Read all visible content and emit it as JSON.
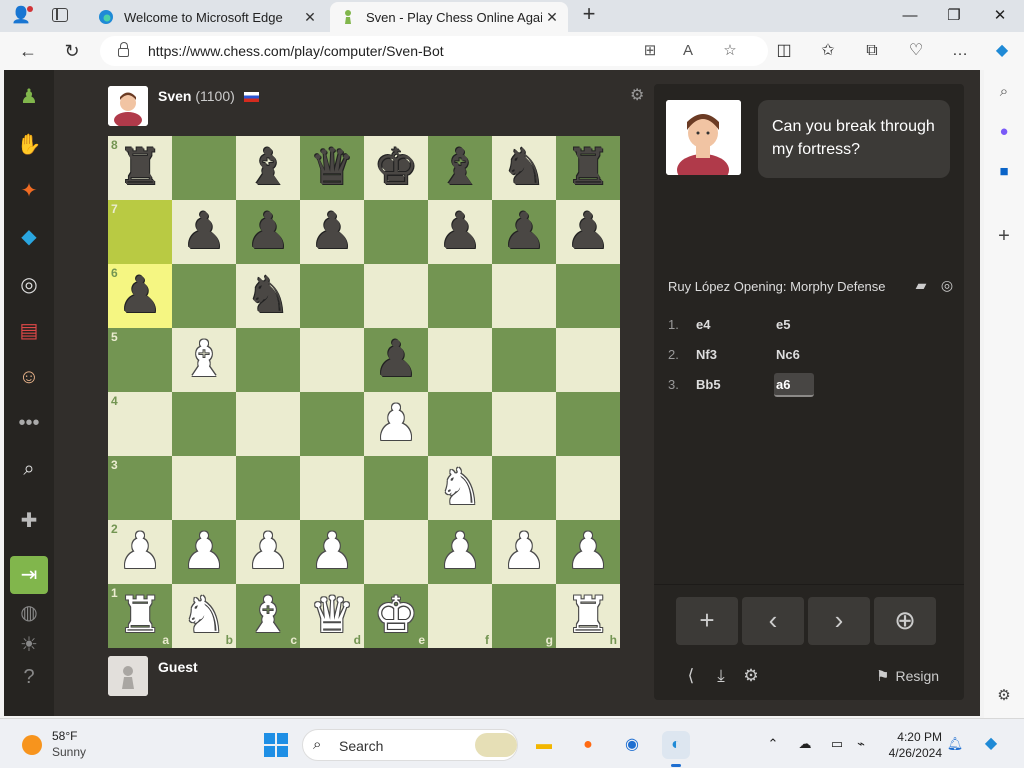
{
  "browser": {
    "tabs": [
      {
        "title": "Welcome to Microsoft Edge",
        "active": false
      },
      {
        "title": "Sven - Play Chess Online Against",
        "active": true
      }
    ],
    "url": "https://www.chess.com/play/computer/Sven-Bot"
  },
  "game": {
    "opponent": {
      "name": "Sven",
      "rating": "(1100)"
    },
    "player": {
      "name": "Guest"
    },
    "coach_message": "Can you break through my fortress?",
    "opening": "Ruy López Opening: Morphy Defense",
    "ranks": [
      "8",
      "7",
      "6",
      "5",
      "4",
      "3",
      "2",
      "1"
    ],
    "files": [
      "a",
      "b",
      "c",
      "d",
      "e",
      "f",
      "g",
      "h"
    ],
    "board": [
      [
        "br",
        "",
        "bb",
        "bq",
        "bk",
        "bb",
        "bn",
        "br"
      ],
      [
        "",
        "bp",
        "bp",
        "bp",
        "",
        "bp",
        "bp",
        "bp"
      ],
      [
        "bp",
        "",
        "bn",
        "",
        "",
        "",
        "",
        ""
      ],
      [
        "",
        "wb",
        "",
        "",
        "bp",
        "",
        "",
        ""
      ],
      [
        "",
        "",
        "",
        "",
        "wp",
        "",
        "",
        ""
      ],
      [
        "",
        "",
        "",
        "",
        "",
        "wn",
        "",
        ""
      ],
      [
        "wp",
        "wp",
        "wp",
        "wp",
        "",
        "wp",
        "wp",
        "wp"
      ],
      [
        "wr",
        "wn",
        "wb",
        "wq",
        "wk",
        "",
        "",
        "wr"
      ]
    ],
    "highlight": [
      [
        1,
        0
      ],
      [
        2,
        0
      ]
    ],
    "moves": [
      {
        "num": "1.",
        "white": "e4",
        "black": "e5"
      },
      {
        "num": "2.",
        "white": "Nf3",
        "black": "Nc6"
      },
      {
        "num": "3.",
        "white": "Bb5",
        "black": "a6"
      }
    ],
    "resign_label": "Resign"
  },
  "taskbar": {
    "temp": "58°F",
    "condition": "Sunny",
    "search_label": "Search",
    "time": "4:20 PM",
    "date": "4/26/2024"
  }
}
